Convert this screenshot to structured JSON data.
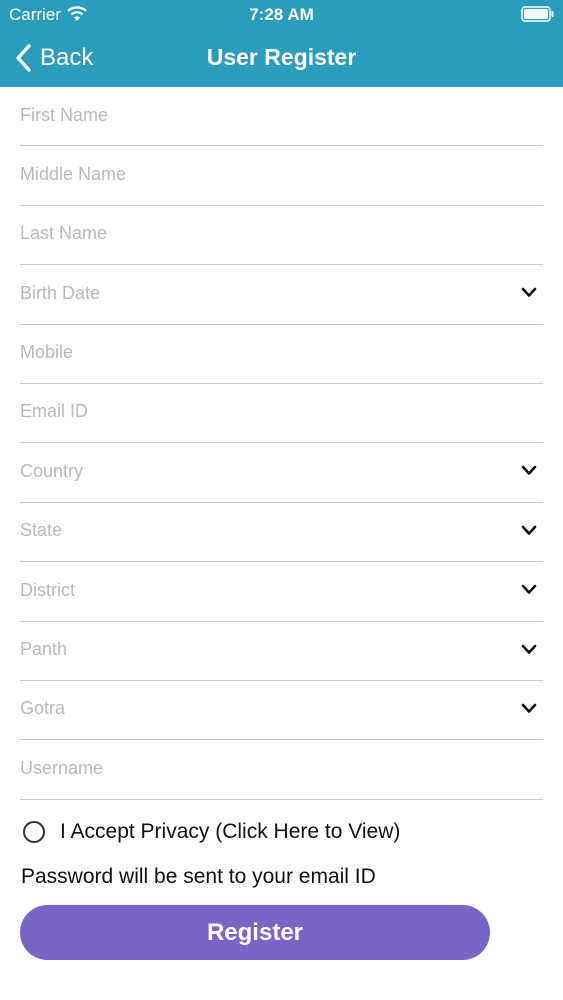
{
  "status_bar": {
    "carrier": "Carrier",
    "time": "7:28 AM",
    "wifi_icon": "wifi-icon",
    "battery_icon": "battery-icon"
  },
  "nav": {
    "back_label": "Back",
    "title": "User Register",
    "back_icon": "chevron-left-icon"
  },
  "colors": {
    "header": "#2b9dbc",
    "register_button": "#7b64c8",
    "placeholder": "#b9b9b9",
    "divider": "#c9c9c9"
  },
  "form": {
    "fields": [
      {
        "placeholder": "First Name",
        "value": "",
        "dropdown": false
      },
      {
        "placeholder": "Middle Name",
        "value": "",
        "dropdown": false
      },
      {
        "placeholder": "Last Name",
        "value": "",
        "dropdown": false
      },
      {
        "placeholder": "Birth Date",
        "value": "",
        "dropdown": true
      },
      {
        "placeholder": "Mobile",
        "value": "",
        "dropdown": false
      },
      {
        "placeholder": "Email ID",
        "value": "",
        "dropdown": false
      },
      {
        "placeholder": "Country",
        "value": "",
        "dropdown": true
      },
      {
        "placeholder": "State",
        "value": "",
        "dropdown": true
      },
      {
        "placeholder": "District",
        "value": "",
        "dropdown": true
      },
      {
        "placeholder": "Panth",
        "value": "",
        "dropdown": true
      },
      {
        "placeholder": "Gotra",
        "value": "",
        "dropdown": true
      },
      {
        "placeholder": "Username",
        "value": "",
        "dropdown": false
      }
    ],
    "privacy_label": "I Accept Privacy (Click Here to View)",
    "privacy_checked": false,
    "password_note": "Password will be sent to your email ID",
    "register_label": "Register"
  }
}
